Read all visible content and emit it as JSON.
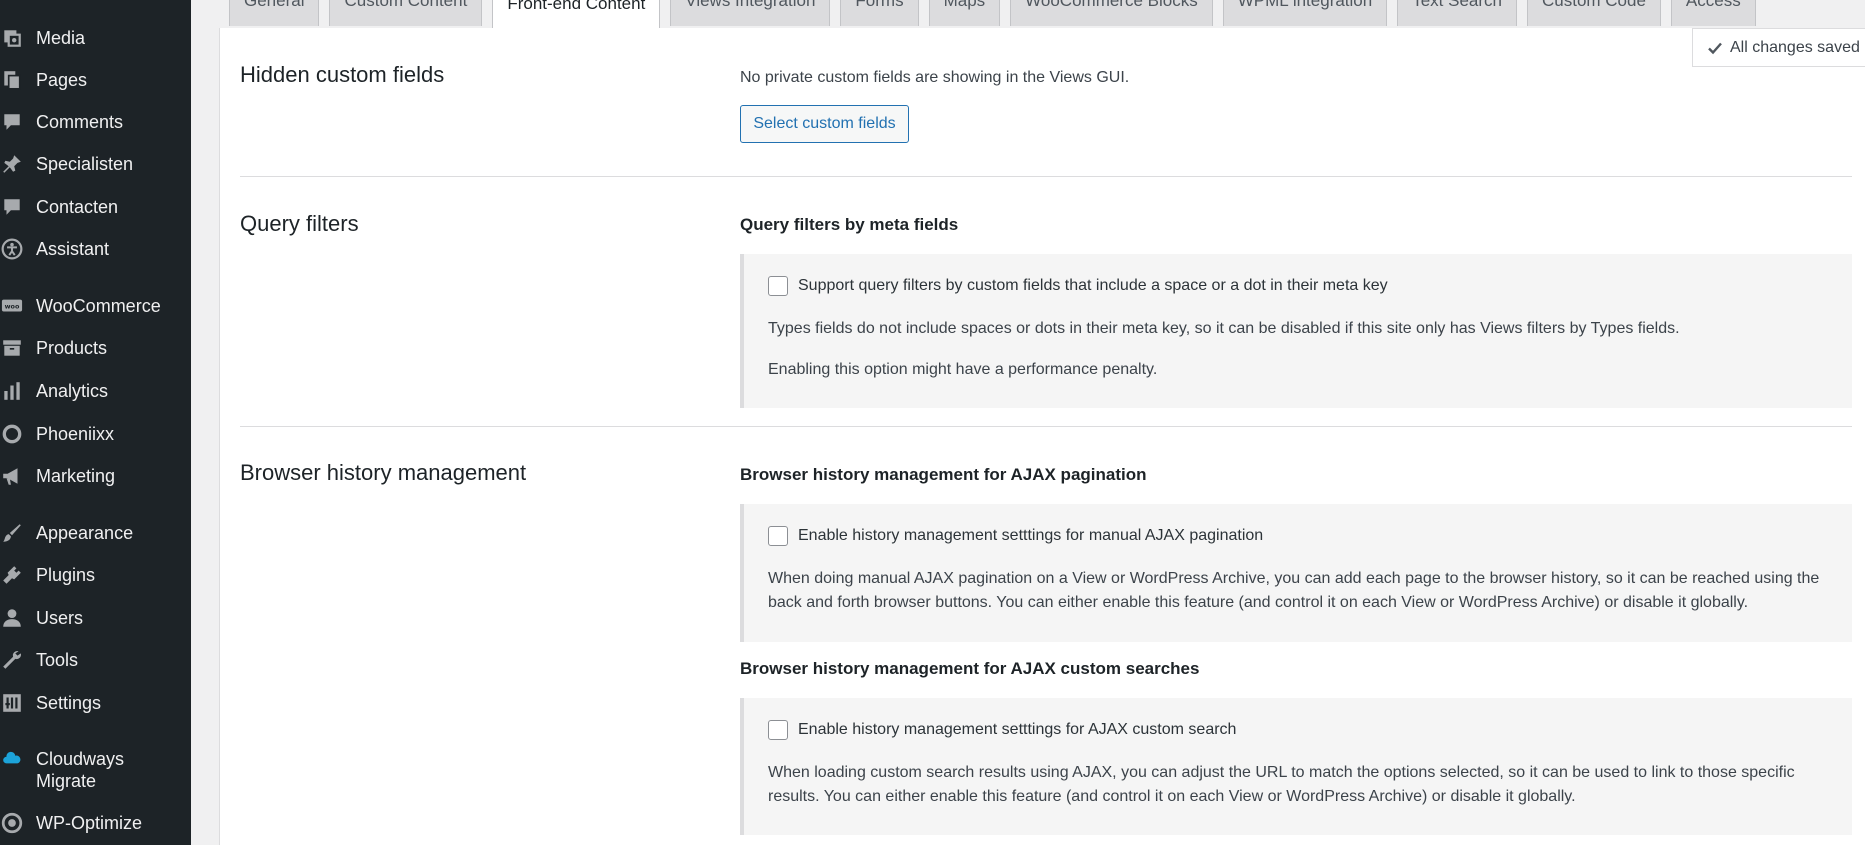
{
  "sidebar": {
    "items": [
      {
        "label": "Media",
        "icon": "media-icon"
      },
      {
        "label": "Pages",
        "icon": "pages-icon"
      },
      {
        "label": "Comments",
        "icon": "comments-icon"
      },
      {
        "label": "Specialisten",
        "icon": "pin-icon"
      },
      {
        "label": "Contacten",
        "icon": "comments-icon"
      },
      {
        "label": "Assistant",
        "icon": "accessibility-icon"
      },
      {
        "label": "WooCommerce",
        "icon": "woocommerce-icon"
      },
      {
        "label": "Products",
        "icon": "archive-icon"
      },
      {
        "label": "Analytics",
        "icon": "analytics-icon"
      },
      {
        "label": "Phoeniixx",
        "icon": "circle-icon"
      },
      {
        "label": "Marketing",
        "icon": "megaphone-icon"
      },
      {
        "label": "Appearance",
        "icon": "brush-icon"
      },
      {
        "label": "Plugins",
        "icon": "plugin-icon"
      },
      {
        "label": "Users",
        "icon": "user-icon"
      },
      {
        "label": "Tools",
        "icon": "wrench-icon"
      },
      {
        "label": "Settings",
        "icon": "settings-icon"
      },
      {
        "label": "Cloudways Migrate",
        "icon": "cloud-icon"
      },
      {
        "label": "WP-Optimize",
        "icon": "optimize-icon"
      }
    ]
  },
  "tabs": [
    {
      "label": "General",
      "active": false
    },
    {
      "label": "Custom Content",
      "active": false
    },
    {
      "label": "Front-end Content",
      "active": true
    },
    {
      "label": "Views Integration",
      "active": false
    },
    {
      "label": "Forms",
      "active": false
    },
    {
      "label": "Maps",
      "active": false
    },
    {
      "label": "WooCommerce Blocks",
      "active": false
    },
    {
      "label": "WPML integration",
      "active": false
    },
    {
      "label": "Text Search",
      "active": false
    },
    {
      "label": "Custom Code",
      "active": false
    },
    {
      "label": "Access",
      "active": false
    }
  ],
  "status": {
    "saved": "All changes saved"
  },
  "hidden_fields": {
    "title": "Hidden custom fields",
    "description": "No private custom fields are showing in the Views GUI.",
    "button": "Select custom fields"
  },
  "query_filters": {
    "title": "Query filters",
    "subtitle": "Query filters by meta fields",
    "checkbox": "Support query filters by custom fields that include a space or a dot in their meta key",
    "checked": false,
    "note1": "Types fields do not include spaces or dots in their meta key, so it can be disabled if this site only has Views filters by Types fields.",
    "note2": "Enabling this option might have a performance penalty."
  },
  "browser_history": {
    "title": "Browser history management",
    "pagination": {
      "subtitle": "Browser history management for AJAX pagination",
      "checkbox": "Enable history management setttings for manual AJAX pagination",
      "checked": false,
      "note": "When doing manual AJAX pagination on a View or WordPress Archive, you can add each page to the browser history, so it can be reached using the back and forth browser buttons. You can either enable this feature (and control it on each View or WordPress Archive) or disable it globally."
    },
    "search": {
      "subtitle": "Browser history management for AJAX custom searches",
      "checkbox": "Enable history management setttings for AJAX custom search",
      "checked": false,
      "note": "When loading custom search results using AJAX, you can adjust the URL to match the options selected, so it can be used to link to those specific results. You can either enable this feature (and control it on each View or WordPress Archive) or disable it globally."
    }
  }
}
